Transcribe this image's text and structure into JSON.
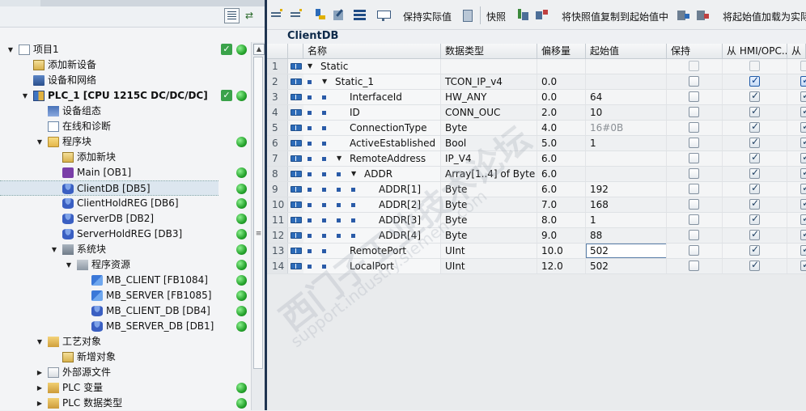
{
  "project_tree": {
    "items": [
      {
        "label": "项目1",
        "level": 0,
        "icon": "project-doc-icon",
        "expand": "▼",
        "check": true,
        "dot": true
      },
      {
        "label": "添加新设备",
        "level": 1,
        "icon": "add-device-icon",
        "expand": "",
        "check": false,
        "dot": false
      },
      {
        "label": "设备和网络",
        "level": 1,
        "icon": "network-icon",
        "expand": "",
        "check": false,
        "dot": false
      },
      {
        "label": "PLC_1 [CPU 1215C DC/DC/DC]",
        "level": 1,
        "icon": "plc-icon",
        "expand": "▼",
        "check": true,
        "dot": true,
        "bold": true
      },
      {
        "label": "设备组态",
        "level": 2,
        "icon": "device-config-icon",
        "expand": "",
        "check": false,
        "dot": false
      },
      {
        "label": "在线和诊断",
        "level": 2,
        "icon": "diagnostics-icon",
        "expand": "",
        "check": false,
        "dot": false
      },
      {
        "label": "程序块",
        "level": 2,
        "icon": "folder-icon",
        "expand": "▼",
        "check": false,
        "dot": true
      },
      {
        "label": "添加新块",
        "level": 3,
        "icon": "add-block-icon",
        "expand": "",
        "check": false,
        "dot": false
      },
      {
        "label": "Main [OB1]",
        "level": 3,
        "icon": "ob-icon",
        "expand": "",
        "check": false,
        "dot": true
      },
      {
        "label": "ClientDB [DB5]",
        "level": 3,
        "icon": "db-icon",
        "expand": "",
        "check": false,
        "dot": true,
        "selected": true
      },
      {
        "label": "ClientHoldREG [DB6]",
        "level": 3,
        "icon": "db-icon",
        "expand": "",
        "check": false,
        "dot": true
      },
      {
        "label": "ServerDB [DB2]",
        "level": 3,
        "icon": "db-icon",
        "expand": "",
        "check": false,
        "dot": true
      },
      {
        "label": "ServerHoldREG [DB3]",
        "level": 3,
        "icon": "db-icon",
        "expand": "",
        "check": false,
        "dot": true
      },
      {
        "label": "系统块",
        "level": 3,
        "icon": "system-block-icon",
        "expand": "▼",
        "check": false,
        "dot": true
      },
      {
        "label": "程序资源",
        "level": 4,
        "icon": "program-resource-icon",
        "expand": "▼",
        "check": false,
        "dot": true
      },
      {
        "label": "MB_CLIENT [FB1084]",
        "level": 5,
        "icon": "fb-icon",
        "expand": "",
        "check": false,
        "dot": true
      },
      {
        "label": "MB_SERVER [FB1085]",
        "level": 5,
        "icon": "fb-icon",
        "expand": "",
        "check": false,
        "dot": true
      },
      {
        "label": "MB_CLIENT_DB [DB4]",
        "level": 5,
        "icon": "db-icon",
        "expand": "",
        "check": false,
        "dot": true
      },
      {
        "label": "MB_SERVER_DB [DB1]",
        "level": 5,
        "icon": "db-icon",
        "expand": "",
        "check": false,
        "dot": true
      },
      {
        "label": "工艺对象",
        "level": 2,
        "icon": "tech-object-icon",
        "expand": "▼",
        "check": false,
        "dot": false
      },
      {
        "label": "新增对象",
        "level": 3,
        "icon": "add-object-icon",
        "expand": "",
        "check": false,
        "dot": false
      },
      {
        "label": "外部源文件",
        "level": 2,
        "icon": "external-source-icon",
        "expand": "▶",
        "check": false,
        "dot": false
      },
      {
        "label": "PLC 变量",
        "level": 2,
        "icon": "plc-tags-icon",
        "expand": "▶",
        "check": false,
        "dot": true
      },
      {
        "label": "PLC 数据类型",
        "level": 2,
        "icon": "plc-datatype-icon",
        "expand": "▶",
        "check": false,
        "dot": true
      }
    ]
  },
  "editor": {
    "toolbar": {
      "keep_actual": "保持实际值",
      "snapshot": "快照",
      "copy_snapshot": "将快照值复制到起始值中",
      "load_start": "将起始值加载为实际"
    },
    "db_title": "ClientDB",
    "columns": {
      "name": "名称",
      "type": "数据类型",
      "offset": "偏移量",
      "start": "起始值",
      "retain": "保持",
      "hmi": "从 HMI/OPC...",
      "hmi2": "从 H"
    },
    "rows": [
      {
        "n": "1",
        "indent": 0,
        "expand": "▼",
        "bullet": false,
        "name": "Static",
        "type": "",
        "offset": "",
        "start": "",
        "retain": "dis",
        "hmi": "dis",
        "hmi2": "dis"
      },
      {
        "n": "2",
        "indent": 1,
        "expand": "▼",
        "bullet": true,
        "name": "Static_1",
        "type": "TCON_IP_v4",
        "offset": "0.0",
        "start": "",
        "retain": "off",
        "hmi": "blue",
        "hmi2": "blue"
      },
      {
        "n": "3",
        "indent": 2,
        "expand": "",
        "bullet": true,
        "name": "InterfaceId",
        "type": "HW_ANY",
        "offset": "0.0",
        "start": "64",
        "retain": "off",
        "hmi": "on",
        "hmi2": "on"
      },
      {
        "n": "4",
        "indent": 2,
        "expand": "",
        "bullet": true,
        "name": "ID",
        "type": "CONN_OUC",
        "offset": "2.0",
        "start": "10",
        "retain": "off",
        "hmi": "on",
        "hmi2": "on"
      },
      {
        "n": "5",
        "indent": 2,
        "expand": "",
        "bullet": true,
        "name": "ConnectionType",
        "type": "Byte",
        "offset": "4.0",
        "start": "16#0B",
        "start_dim": true,
        "retain": "off",
        "hmi": "on",
        "hmi2": "on"
      },
      {
        "n": "6",
        "indent": 2,
        "expand": "",
        "bullet": true,
        "name": "ActiveEstablished",
        "type": "Bool",
        "offset": "5.0",
        "start": "1",
        "retain": "off",
        "hmi": "on",
        "hmi2": "on"
      },
      {
        "n": "7",
        "indent": 2,
        "expand": "▼",
        "bullet": true,
        "name": "RemoteAddress",
        "type": "IP_V4",
        "offset": "6.0",
        "start": "",
        "retain": "off",
        "hmi": "on",
        "hmi2": "on"
      },
      {
        "n": "8",
        "indent": 3,
        "expand": "▼",
        "bullet": true,
        "name": "ADDR",
        "type": "Array[1..4] of Byte",
        "offset": "6.0",
        "start": "",
        "retain": "off",
        "hmi": "on",
        "hmi2": "on"
      },
      {
        "n": "9",
        "indent": 4,
        "expand": "",
        "bullet": true,
        "name": "ADDR[1]",
        "type": "Byte",
        "offset": "6.0",
        "start": "192",
        "retain": "off",
        "hmi": "on",
        "hmi2": "on"
      },
      {
        "n": "10",
        "indent": 4,
        "expand": "",
        "bullet": true,
        "name": "ADDR[2]",
        "type": "Byte",
        "offset": "7.0",
        "start": "168",
        "retain": "off",
        "hmi": "on",
        "hmi2": "on"
      },
      {
        "n": "11",
        "indent": 4,
        "expand": "",
        "bullet": true,
        "name": "ADDR[3]",
        "type": "Byte",
        "offset": "8.0",
        "start": "1",
        "retain": "off",
        "hmi": "on",
        "hmi2": "on"
      },
      {
        "n": "12",
        "indent": 4,
        "expand": "",
        "bullet": true,
        "name": "ADDR[4]",
        "type": "Byte",
        "offset": "9.0",
        "start": "88",
        "retain": "off",
        "hmi": "on",
        "hmi2": "on"
      },
      {
        "n": "13",
        "indent": 2,
        "expand": "",
        "bullet": true,
        "name": "RemotePort",
        "type": "UInt",
        "offset": "10.0",
        "start": "502",
        "editing": true,
        "retain": "off",
        "hmi": "on",
        "hmi2": "on"
      },
      {
        "n": "14",
        "indent": 2,
        "expand": "",
        "bullet": true,
        "name": "LocalPort",
        "type": "UInt",
        "offset": "12.0",
        "start": "502",
        "retain": "off",
        "hmi": "on",
        "hmi2": "on"
      }
    ]
  },
  "colors": {
    "status_ok": "#25a32c",
    "divider": "#1f3450",
    "accent_blue": "#2c6bb8"
  }
}
